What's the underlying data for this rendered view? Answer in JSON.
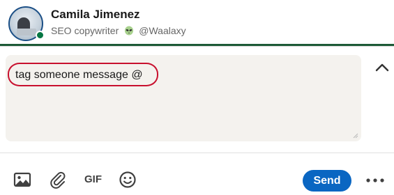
{
  "profile": {
    "name": "Camila Jimenez",
    "headline_role": "SEO copywriter",
    "headline_handle": "@Waalaxy",
    "presence": "online",
    "avatar_icon": "profile-photo",
    "emoji_icon": "alien-emoji-icon"
  },
  "composer": {
    "message_text": "tag someone message @",
    "background_color": "#f4f2ee",
    "highlight_color": "#c8102e"
  },
  "toolbar": {
    "image_icon": "image-icon",
    "attach_icon": "paperclip-icon",
    "gif_label": "GIF",
    "emoji_icon": "smiley-icon",
    "send_label": "Send",
    "more_icon": "ellipsis-icon",
    "collapse_icon": "chevron-up-icon"
  },
  "colors": {
    "accent": "#0a66c2",
    "divider": "#1d5a37",
    "online": "#057642"
  }
}
